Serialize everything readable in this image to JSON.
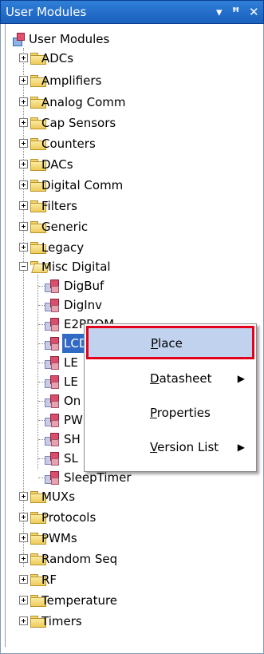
{
  "titlebar": {
    "title": "User Modules",
    "buttons": {
      "dropdown": "▾",
      "pin": "ꟸ",
      "close": "✕"
    }
  },
  "tree": {
    "root": "User Modules",
    "folders": [
      "ADCs",
      "Amplifiers",
      "Analog Comm",
      "Cap Sensors",
      "Counters",
      "DACs",
      "Digital Comm",
      "Filters",
      "Generic",
      "Legacy"
    ],
    "open_folder": "Misc Digital",
    "children": [
      "DigBuf",
      "DigInv",
      "E2PROM",
      "LCD",
      "LE",
      "LE",
      "On",
      "PW",
      "SH",
      "SL",
      "SleepTimer"
    ],
    "selected_child": "LCD",
    "folders_after": [
      "MUXs",
      "Protocols",
      "PWMs",
      "Random Seq",
      "RF",
      "Temperature",
      "Timers"
    ]
  },
  "context_menu": {
    "items": [
      {
        "label": "Place",
        "underline": "P",
        "rest": "lace",
        "submenu": false,
        "highlighted": true
      },
      {
        "label": "Datasheet",
        "underline": "D",
        "rest": "atasheet",
        "submenu": true
      },
      {
        "label": "Properties",
        "underline": "P",
        "rest": "roperties",
        "submenu": false
      },
      {
        "label": "Version List",
        "underline": "V",
        "rest": "ersion List",
        "submenu": true
      }
    ],
    "submenu_arrow": "▶"
  },
  "colors": {
    "selection": "#316ac5",
    "highlight_border": "#e3001b",
    "titlebar": "#2f7fd8"
  }
}
